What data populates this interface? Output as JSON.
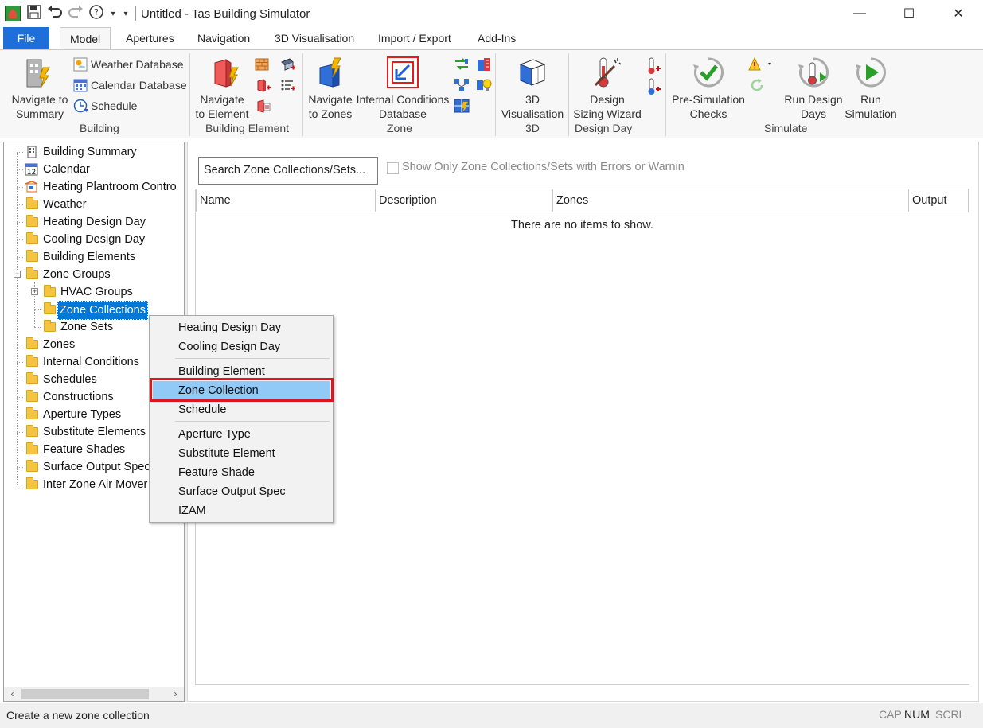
{
  "window": {
    "title": "Untitled - Tas Building Simulator",
    "minimize": "—",
    "maximize": "☐",
    "close": "✕"
  },
  "quick_access": {
    "save_icon": "save-icon",
    "undo_icon": "undo-icon",
    "redo_icon": "redo-icon",
    "help_icon": "help-icon"
  },
  "tabs": [
    "File",
    "Model",
    "Apertures",
    "Navigation",
    "3D Visualisation",
    "Import / Export",
    "Add-Ins"
  ],
  "active_tab": "Model",
  "ribbon": {
    "building": {
      "group_label": "Building",
      "navigate_summary": "Navigate to\nSummary",
      "weather_db": "Weather Database",
      "calendar_db": "Calendar Database",
      "schedule": "Schedule"
    },
    "building_element": {
      "group_label": "Building Element",
      "navigate_element": "Navigate\nto Element"
    },
    "zone": {
      "group_label": "Zone",
      "navigate_zones": "Navigate\nto Zones",
      "internal_conditions_db": "Internal Conditions\nDatabase"
    },
    "three_d": {
      "group_label": "3D",
      "visualisation": "3D\nVisualisation"
    },
    "design_day": {
      "group_label": "Design Day",
      "sizing_wizard": "Design\nSizing Wizard"
    },
    "simulate": {
      "group_label": "Simulate",
      "pre_sim": "Pre-Simulation\nChecks",
      "run_design_days": "Run Design\nDays",
      "run_simulation": "Run\nSimulation"
    }
  },
  "tree": {
    "items": [
      {
        "label": "Building Summary",
        "icon": "building-icon"
      },
      {
        "label": "Calendar",
        "icon": "calendar-icon"
      },
      {
        "label": "Heating Plantroom Contro",
        "icon": "plantroom-icon"
      },
      {
        "label": "Weather",
        "icon": "folder-icon"
      },
      {
        "label": "Heating Design Day",
        "icon": "folder-icon"
      },
      {
        "label": "Cooling Design Day",
        "icon": "folder-icon"
      },
      {
        "label": "Building Elements",
        "icon": "folder-icon"
      },
      {
        "label": "Zone Groups",
        "icon": "folder-icon"
      },
      {
        "label": "HVAC Groups",
        "icon": "folder-icon"
      },
      {
        "label": "Zone Collections",
        "icon": "folder-icon"
      },
      {
        "label": "Zone Sets",
        "icon": "folder-icon"
      },
      {
        "label": "Zones",
        "icon": "folder-icon"
      },
      {
        "label": "Internal Conditions",
        "icon": "folder-icon"
      },
      {
        "label": "Schedules",
        "icon": "folder-icon"
      },
      {
        "label": "Constructions",
        "icon": "folder-icon"
      },
      {
        "label": "Aperture Types",
        "icon": "folder-icon"
      },
      {
        "label": "Substitute Elements",
        "icon": "folder-icon"
      },
      {
        "label": "Feature Shades",
        "icon": "folder-icon"
      },
      {
        "label": "Surface Output Spec",
        "icon": "folder-icon"
      },
      {
        "label": "Inter Zone Air Mover",
        "icon": "folder-icon"
      }
    ],
    "selected": "Zone Collections"
  },
  "main": {
    "search_button": "Search Zone Collections/Sets...",
    "filter_label": "Show Only Zone Collections/Sets with Errors or Warnin",
    "columns": [
      "Name",
      "Description",
      "Zones",
      "Output"
    ],
    "empty_message": "There are no items to show."
  },
  "context_menu": {
    "items": [
      "Heating Design Day",
      "Cooling Design Day",
      "Building Element",
      "Zone Collection",
      "Schedule",
      "Aperture Type",
      "Substitute Element",
      "Feature Shade",
      "Surface Output Spec",
      "IZAM"
    ],
    "highlighted": "Zone Collection"
  },
  "status": {
    "text": "Create a new zone collection",
    "indicators": [
      "CAP",
      "NUM",
      "SCRL"
    ],
    "active_indicator": "NUM"
  },
  "colors": {
    "file_tab": "#1e6fd9",
    "selection": "#0078d7",
    "menu_highlight": "#91c9f7",
    "annotation_box": "#e0141e"
  }
}
